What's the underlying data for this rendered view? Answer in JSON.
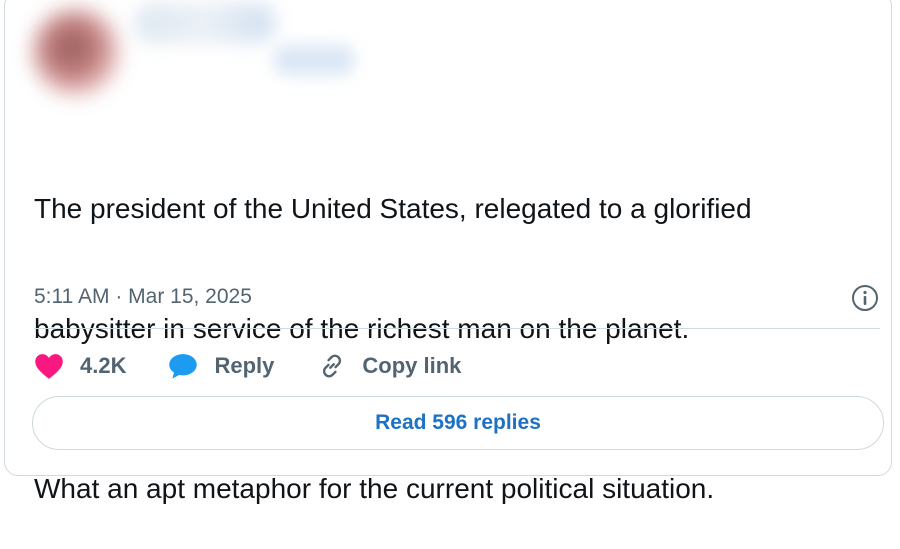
{
  "tweet": {
    "text_line_1": "The president of the United States, relegated to a glorified",
    "text_line_2": "babysitter in service of the richest man on the planet.",
    "text_paragraph_2": "What an apt metaphor for the current political situation.",
    "timestamp": "5:11 AM · Mar 15, 2025"
  },
  "actions": {
    "like_count": "4.2K",
    "reply_label": "Reply",
    "copy_link_label": "Copy link",
    "like_icon": "heart-icon",
    "reply_icon": "speech-bubble-icon",
    "copy_icon": "link-icon",
    "info_icon": "info-icon"
  },
  "read_replies": {
    "label": "Read 596 replies"
  },
  "colors": {
    "like": "#f91880",
    "reply": "#1d9bf0",
    "link_text": "#1d72c4",
    "secondary_text": "#536471",
    "primary_text": "#0f1419",
    "border": "#cfd9de"
  }
}
